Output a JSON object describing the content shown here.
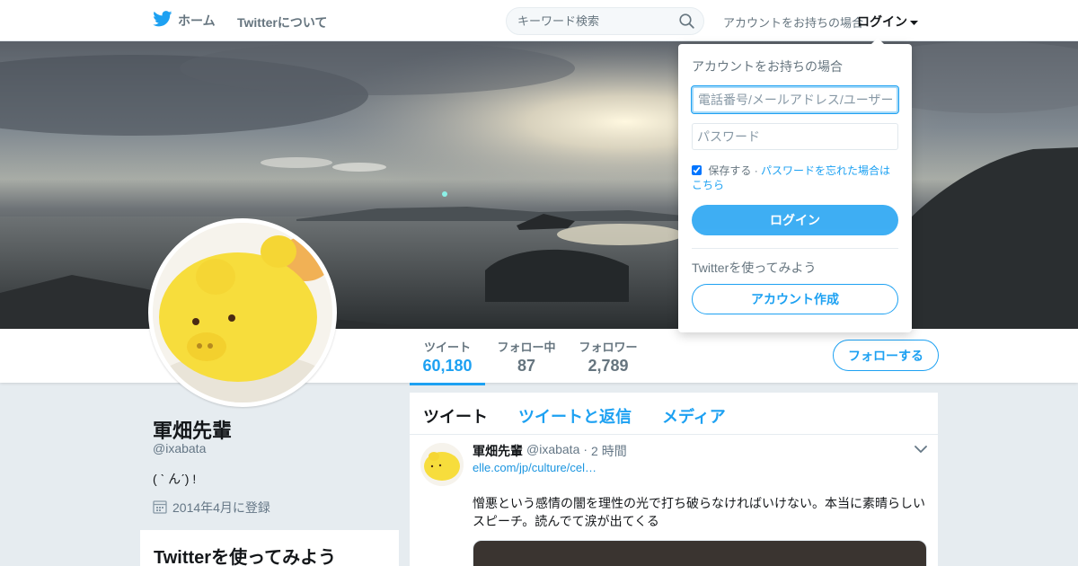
{
  "nav": {
    "home_label": "ホーム",
    "about_label": "Twitterについて",
    "search_placeholder": "キーワード検索",
    "login_prompt": "アカウントをお持ちの場合",
    "login_label": "ログイン"
  },
  "profile": {
    "name": "軍畑先輩",
    "handle": "@ixabata",
    "bio": "( ˋ んˊ) !",
    "joined": "2014年4月に登録",
    "stats": [
      {
        "label": "ツイート",
        "value": "60,180"
      },
      {
        "label": "フォロー中",
        "value": "87"
      },
      {
        "label": "フォロワー",
        "value": "2,789"
      }
    ],
    "follow_label": "フォローする"
  },
  "side_card": {
    "title": "Twitterを使ってみよう"
  },
  "timeline": {
    "tabs": [
      "ツイート",
      "ツイートと返信",
      "メディア"
    ],
    "tweet": {
      "name": "軍畑先輩",
      "handle": "@ixabata",
      "separator": "·",
      "time": "2 時間",
      "link": "elle.com/jp/culture/cel…",
      "text": "憎悪という感情の闇を理性の光で打ち破らなければいけない。本当に素晴らしいスピーチ。読んでて涙が出てくる"
    }
  },
  "login_dropdown": {
    "title": "アカウントをお持ちの場合",
    "username_placeholder": "電話番号/メールアドレス/ユーザー名",
    "password_placeholder": "パスワード",
    "remember_label": "保存する",
    "separator": "·",
    "forgot_label": "パスワードを忘れた場合はこちら",
    "login_button": "ログイン",
    "try_label": "Twitterを使ってみよう",
    "signup_button": "アカウント作成"
  },
  "colors": {
    "accent": "#1da1f2",
    "text": "#14171a",
    "muted": "#657786",
    "page_bg": "#e6ecf0"
  }
}
